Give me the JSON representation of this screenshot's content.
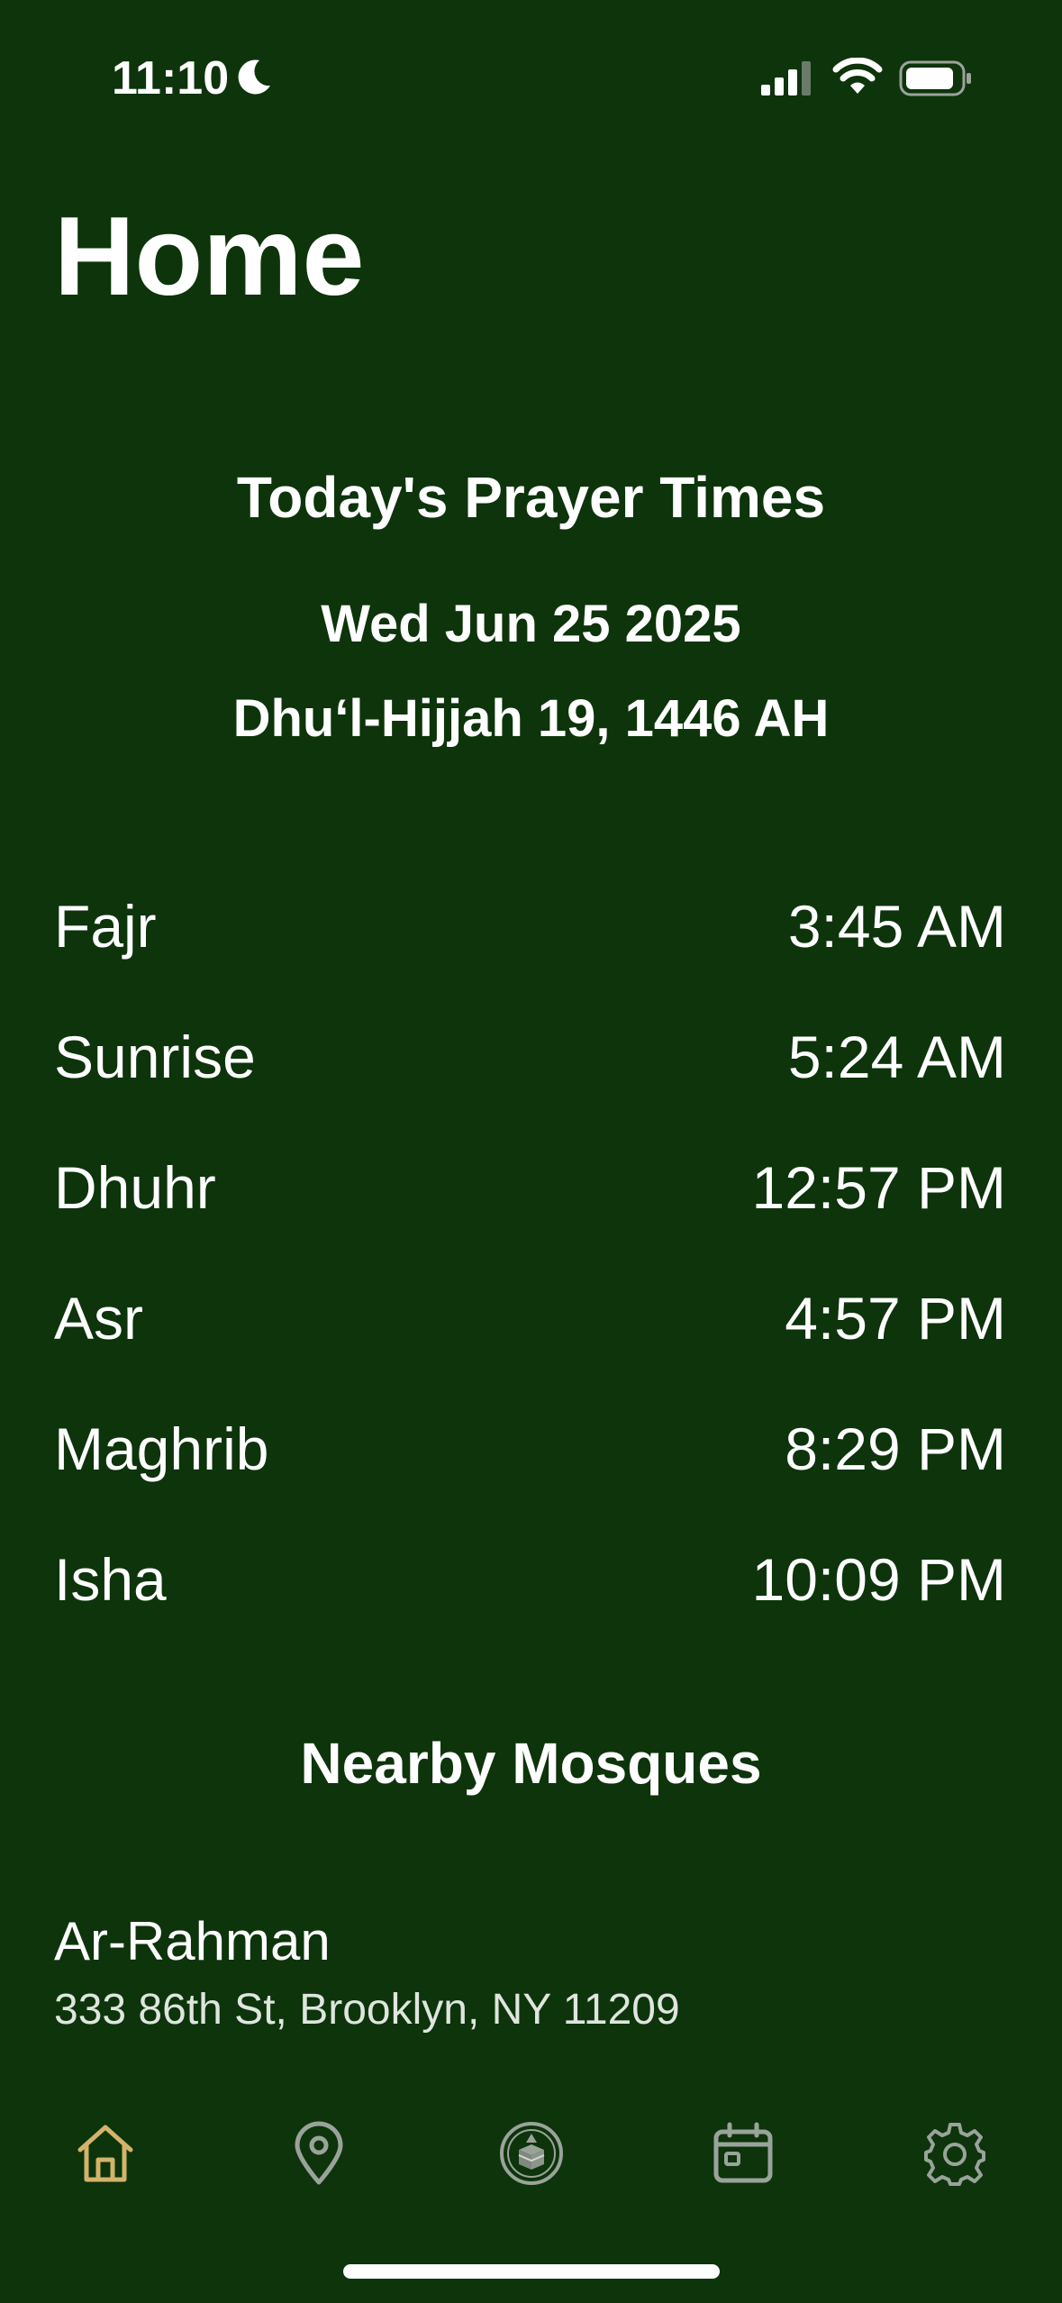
{
  "status_bar": {
    "time": "11:10",
    "icons": [
      "moon-icon",
      "cellular-signal-icon",
      "wifi-icon",
      "battery-icon"
    ]
  },
  "page": {
    "title": "Home"
  },
  "prayer_times": {
    "heading": "Today's Prayer Times",
    "gregorian_date": "Wed Jun 25 2025",
    "hijri_date": "Dhuʻl-Hijjah 19, 1446 AH",
    "items": [
      {
        "name": "Fajr",
        "time": "3:45 AM"
      },
      {
        "name": "Sunrise",
        "time": "5:24 AM"
      },
      {
        "name": "Dhuhr",
        "time": "12:57 PM"
      },
      {
        "name": "Asr",
        "time": "4:57 PM"
      },
      {
        "name": "Maghrib",
        "time": "8:29 PM"
      },
      {
        "name": "Isha",
        "time": "10:09 PM"
      }
    ]
  },
  "nearby_mosques": {
    "heading": "Nearby Mosques",
    "items": [
      {
        "name": "Ar-Rahman",
        "address": "333 86th St, Brooklyn, NY 11209"
      }
    ]
  },
  "tab_bar": {
    "tabs": [
      {
        "icon": "home-icon",
        "active": true
      },
      {
        "icon": "location-pin-icon",
        "active": false
      },
      {
        "icon": "qibla-kaaba-icon",
        "active": false
      },
      {
        "icon": "calendar-icon",
        "active": false
      },
      {
        "icon": "gear-icon",
        "active": false
      }
    ]
  },
  "colors": {
    "background": "#0d340b",
    "text": "#ffffff",
    "active_tab": "#d4b36a",
    "inactive_tab": "#9aa39a"
  }
}
